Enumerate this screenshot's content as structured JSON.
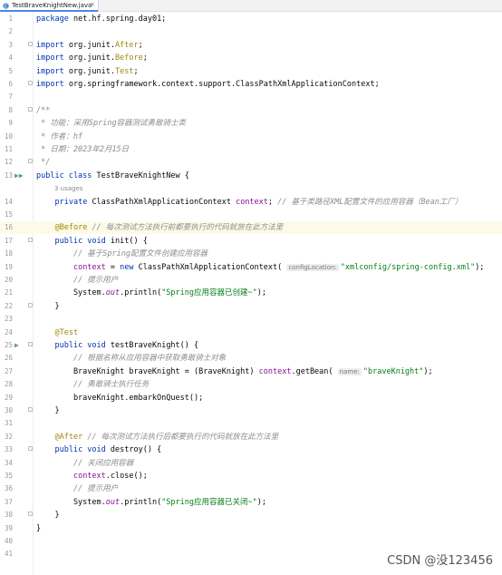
{
  "tab": {
    "title": "TestBraveKnightNew.java",
    "close": "×"
  },
  "usages": "3 usages",
  "lines": [
    {
      "n": "1",
      "segs": [
        [
          "k",
          "package "
        ],
        [
          "",
          "net.hf.spring.day01;"
        ]
      ]
    },
    {
      "n": "2",
      "segs": []
    },
    {
      "n": "3",
      "segs": [
        [
          "k",
          "import "
        ],
        [
          "",
          "org.junit."
        ],
        [
          "a",
          "After"
        ],
        [
          "",
          ";"
        ]
      ]
    },
    {
      "n": "4",
      "segs": [
        [
          "k",
          "import "
        ],
        [
          "",
          "org.junit."
        ],
        [
          "a",
          "Before"
        ],
        [
          "",
          ";"
        ]
      ]
    },
    {
      "n": "5",
      "segs": [
        [
          "k",
          "import "
        ],
        [
          "",
          "org.junit."
        ],
        [
          "a",
          "Test"
        ],
        [
          "",
          ";"
        ]
      ]
    },
    {
      "n": "6",
      "segs": [
        [
          "k",
          "import "
        ],
        [
          "",
          "org.springframework.context.support.ClassPathXmlApplicationContext;"
        ]
      ]
    },
    {
      "n": "7",
      "segs": []
    },
    {
      "n": "8",
      "segs": [
        [
          "c",
          "/**"
        ]
      ]
    },
    {
      "n": "9",
      "segs": [
        [
          "c",
          " * 功能：采用Spring容器测试勇敢骑士类"
        ]
      ]
    },
    {
      "n": "10",
      "segs": [
        [
          "c",
          " * 作者：hf"
        ]
      ]
    },
    {
      "n": "11",
      "segs": [
        [
          "c",
          " * 日期：2023年2月15日"
        ]
      ]
    },
    {
      "n": "12",
      "segs": [
        [
          "c",
          " */"
        ]
      ]
    },
    {
      "n": "13",
      "segs": [
        [
          "k",
          "public class "
        ],
        [
          "",
          "TestBraveKnightNew {"
        ]
      ]
    },
    {
      "n": "14",
      "segs": [
        [
          "",
          "    "
        ],
        [
          "k",
          "private "
        ],
        [
          "",
          "ClassPathXmlApplicationContext "
        ],
        [
          "f",
          "context"
        ],
        [
          "",
          "; "
        ],
        [
          "c",
          "// 基于类路径XML配置文件的应用容器（Bean工厂）"
        ]
      ]
    },
    {
      "n": "15",
      "segs": []
    },
    {
      "n": "16",
      "segs": [
        [
          "",
          "    "
        ],
        [
          "a",
          "@Before "
        ],
        [
          "c",
          "// 每次测试方法执行前都要执行的代码就放在此方法里"
        ]
      ]
    },
    {
      "n": "17",
      "segs": [
        [
          "",
          "    "
        ],
        [
          "k",
          "public void "
        ],
        [
          "",
          "init() {"
        ]
      ]
    },
    {
      "n": "18",
      "segs": [
        [
          "",
          "        "
        ],
        [
          "c",
          "// 基于Spring配置文件创建应用容器"
        ]
      ]
    },
    {
      "n": "19",
      "segs": [
        [
          "",
          "        "
        ],
        [
          "f",
          "context"
        ],
        [
          "",
          " = "
        ],
        [
          "k",
          "new "
        ],
        [
          "",
          "ClassPathXmlApplicationContext( "
        ],
        [
          "ph",
          "configLocation:"
        ],
        [
          "s",
          "\"xmlconfig/spring-config.xml\""
        ],
        [
          "",
          ");"
        ]
      ]
    },
    {
      "n": "20",
      "segs": [
        [
          "",
          "        "
        ],
        [
          "c",
          "// 提示用户"
        ]
      ]
    },
    {
      "n": "21",
      "segs": [
        [
          "",
          "        System."
        ],
        [
          "st",
          "out"
        ],
        [
          "",
          ".println("
        ],
        [
          "s",
          "\"Spring应用容器已创建~\""
        ],
        [
          "",
          ");"
        ]
      ]
    },
    {
      "n": "22",
      "segs": [
        [
          "",
          "    }"
        ]
      ]
    },
    {
      "n": "23",
      "segs": []
    },
    {
      "n": "24",
      "segs": [
        [
          "",
          "    "
        ],
        [
          "a",
          "@Test"
        ]
      ]
    },
    {
      "n": "25",
      "segs": [
        [
          "",
          "    "
        ],
        [
          "k",
          "public void "
        ],
        [
          "",
          "testBraveKnight() {"
        ]
      ]
    },
    {
      "n": "26",
      "segs": [
        [
          "",
          "        "
        ],
        [
          "c",
          "// 根据名称从应用容器中获取勇敢骑士对象"
        ]
      ]
    },
    {
      "n": "27",
      "segs": [
        [
          "",
          "        BraveKnight braveKnight = (BraveKnight) "
        ],
        [
          "f",
          "context"
        ],
        [
          "",
          ".getBean( "
        ],
        [
          "ph",
          "name:"
        ],
        [
          "s",
          "\"braveKnight\""
        ],
        [
          "",
          ");"
        ]
      ]
    },
    {
      "n": "28",
      "segs": [
        [
          "",
          "        "
        ],
        [
          "c",
          "// 勇敢骑士执行任务"
        ]
      ]
    },
    {
      "n": "29",
      "segs": [
        [
          "",
          "        braveKnight.embarkOnQuest();"
        ]
      ]
    },
    {
      "n": "30",
      "segs": [
        [
          "",
          "    }"
        ]
      ]
    },
    {
      "n": "31",
      "segs": []
    },
    {
      "n": "32",
      "segs": [
        [
          "",
          "    "
        ],
        [
          "a",
          "@After "
        ],
        [
          "c",
          "// 每次测试方法执行后都要执行的代码就放在此方法里"
        ]
      ]
    },
    {
      "n": "33",
      "segs": [
        [
          "",
          "    "
        ],
        [
          "k",
          "public void "
        ],
        [
          "",
          "destroy() {"
        ]
      ]
    },
    {
      "n": "34",
      "segs": [
        [
          "",
          "        "
        ],
        [
          "c",
          "// 关闭应用容器"
        ]
      ]
    },
    {
      "n": "35",
      "segs": [
        [
          "",
          "        "
        ],
        [
          "f",
          "context"
        ],
        [
          "",
          ".close();"
        ]
      ]
    },
    {
      "n": "36",
      "segs": [
        [
          "",
          "        "
        ],
        [
          "c",
          "// 提示用户"
        ]
      ]
    },
    {
      "n": "37",
      "segs": [
        [
          "",
          "        System."
        ],
        [
          "st",
          "out"
        ],
        [
          "",
          ".println("
        ],
        [
          "s",
          "\"Spring应用容器已关闭~\""
        ],
        [
          "",
          ");"
        ]
      ]
    },
    {
      "n": "38",
      "segs": [
        [
          "",
          "    }"
        ]
      ]
    },
    {
      "n": "39",
      "segs": [
        [
          "",
          "}"
        ]
      ]
    },
    {
      "n": "40",
      "segs": []
    },
    {
      "n": "41",
      "segs": []
    }
  ],
  "run_markers": {
    "13": "▶▶",
    "25": "▶"
  },
  "highlight_line": "16",
  "watermark": "CSDN @没123456",
  "colors": {
    "keyword": "#0033b3",
    "string": "#067d17",
    "comment": "#8c8c8c",
    "annotation": "#9e880d",
    "field": "#871094"
  }
}
